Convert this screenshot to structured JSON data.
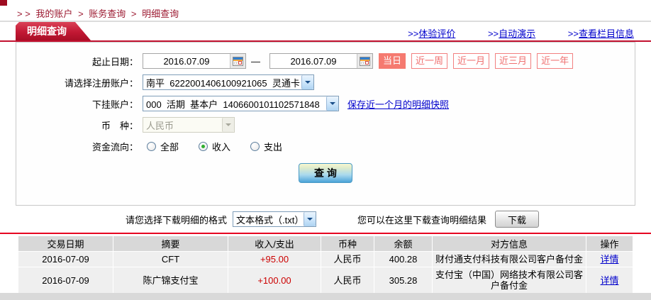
{
  "breadcrumb": {
    "prefix": "> >",
    "items": [
      "我的账户",
      "账务查询",
      "明细查询"
    ],
    "separator": ">"
  },
  "header": {
    "tab_title": "明细查询",
    "links": [
      {
        "prefix": ">>",
        "label": "体验评价"
      },
      {
        "prefix": ">>",
        "label": "自动演示"
      },
      {
        "prefix": ">>",
        "label": "查看栏目信息"
      }
    ]
  },
  "form": {
    "date_label": "起止日期：",
    "date_from": "2016.07.09",
    "date_to": "2016.07.09",
    "date_separator": "—",
    "period_buttons": [
      {
        "label": "当日",
        "active": true
      },
      {
        "label": "近一周",
        "active": false
      },
      {
        "label": "近一月",
        "active": false
      },
      {
        "label": "近三月",
        "active": false
      },
      {
        "label": "近一年",
        "active": false
      }
    ],
    "register_account_label": "请选择注册账户：",
    "register_account_value": "南平  6222001406100921065  灵通卡",
    "sub_account_label": "下挂账户：",
    "sub_account_value": "000  活期  基本户  1406600101102571848",
    "snapshot_link": "保存近一个月的明细快照",
    "currency_label": "币　种：",
    "currency_value": "人民币",
    "flow_label": "资金流向：",
    "flow_options": [
      {
        "label": "全部",
        "checked": false
      },
      {
        "label": "收入",
        "checked": true
      },
      {
        "label": "支出",
        "checked": false
      }
    ],
    "query_button": "查 询"
  },
  "download": {
    "format_label": "请您选择下载明细的格式",
    "format_value": "文本格式（.txt）",
    "hint": "您可以在这里下载查询明细结果",
    "button": "下载"
  },
  "table": {
    "headers": [
      "交易日期",
      "摘要",
      "收入/支出",
      "币种",
      "余额",
      "对方信息",
      "操作"
    ],
    "rows": [
      {
        "date": "2016-07-09",
        "summary": "CFT",
        "amount": "+95.00",
        "currency": "人民币",
        "balance": "400.28",
        "counterparty": "财付通支付科技有限公司客户备付金",
        "action": "详情"
      },
      {
        "date": "2016-07-09",
        "summary": "陈广锦支付宝",
        "amount": "+100.00",
        "currency": "人民币",
        "balance": "305.28",
        "counterparty": "支付宝（中国）网络技术有限公司客户备付金",
        "action": "详情"
      }
    ]
  },
  "colors": {
    "accent_red": "#c31230",
    "table_rule_red": "#e60021",
    "link_blue": "#0000cc",
    "amount_red": "#cc0000",
    "period_salmon": "#f57a70"
  }
}
